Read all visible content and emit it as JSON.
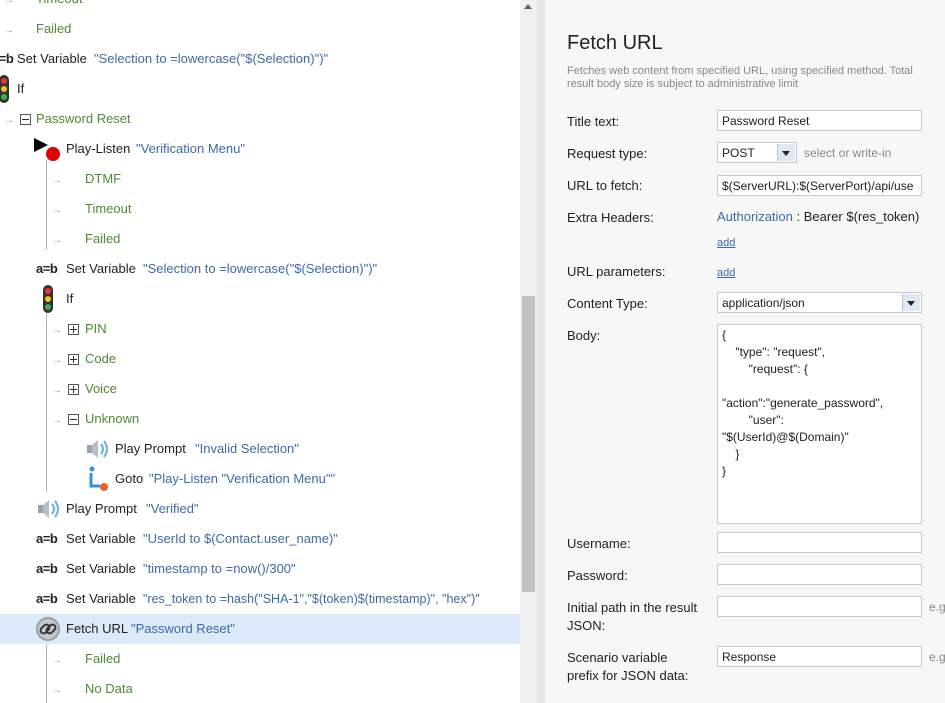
{
  "tree": {
    "rows": [
      {
        "text": "Timeout"
      },
      {
        "text": "Failed"
      },
      {
        "keyword": "Set Variable",
        "arg": "\"Selection to =lowercase(\"$(Selection)\")\""
      },
      {
        "keyword": "If"
      },
      {
        "text": "Password Reset"
      },
      {
        "keyword": "Play-Listen",
        "arg": "\"Verification Menu\""
      },
      {
        "text": "DTMF"
      },
      {
        "text": "Timeout"
      },
      {
        "text": "Failed"
      },
      {
        "keyword": "Set Variable",
        "arg": "\"Selection to =lowercase(\"$(Selection)\")\""
      },
      {
        "keyword": "If"
      },
      {
        "text": "PIN"
      },
      {
        "text": "Code"
      },
      {
        "text": "Voice"
      },
      {
        "text": "Unknown"
      },
      {
        "keyword": "Play Prompt",
        "arg": "\"Invalid Selection\""
      },
      {
        "keyword": "Goto",
        "arg": "\"Play-Listen \"Verification Menu\"\""
      },
      {
        "keyword": "Play Prompt",
        "arg": "\"Verified\""
      },
      {
        "keyword": "Set Variable",
        "arg": "\"UserId to $(Contact.user_name)\""
      },
      {
        "keyword": "Set Variable",
        "arg": "\"timestamp to =now()/300\""
      },
      {
        "keyword": "Set Variable",
        "arg": "\"res_token to =hash(\"SHA-1\",\"$(token)$(timestamp)\", \"hex\")\""
      },
      {
        "keyword": "Fetch URL",
        "arg": "\"Password Reset\""
      },
      {
        "text": "Failed"
      },
      {
        "text": "No Data"
      }
    ],
    "var_icon": "a=b"
  },
  "panel": {
    "title": "Fetch URL",
    "description": "Fetches web content from specified URL, using specified method. Total result body size is subject to administrative limit",
    "title_text_label": "Title text:",
    "title_text_value": "Password Reset",
    "request_type_label": "Request type:",
    "request_type_value": "POST",
    "request_type_hint": "select or write-in",
    "url_label": "URL to fetch:",
    "url_value": "$(ServerURL):$(ServerPort)/api/use",
    "extra_headers_label": "Extra Headers:",
    "header_name": "Authorization",
    "header_value": ": Bearer $(res_token)",
    "add_label": "add",
    "url_params_label": "URL parameters:",
    "content_type_label": "Content Type:",
    "content_type_value": "application/json",
    "body_label": "Body:",
    "body_value": "{\n    \"type\": \"request\",\n        \"request\": {\n\n\"action\":\"generate_password\",\n        \"user\":\n\"$(UserId)@$(Domain)\"\n    }\n}",
    "username_label": "Username:",
    "username_value": "",
    "password_label": "Password:",
    "password_value": "",
    "initial_path_label": "Initial path in the result JSON:",
    "initial_path_value": "",
    "eg_hint": "e.g",
    "prefix_label": "Scenario variable prefix for JSON data:",
    "prefix_value": "Response"
  }
}
